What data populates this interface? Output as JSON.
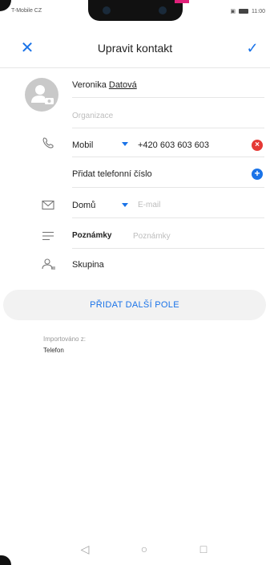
{
  "status_bar": {
    "carrier": "T-Mobile CZ",
    "time": "11:00"
  },
  "header": {
    "title": "Upravit kontakt"
  },
  "contact": {
    "first_name": "Veronika",
    "last_name": "Datová",
    "organization_placeholder": "Organizace"
  },
  "phone": {
    "type_label": "Mobil",
    "number": "+420 603 603 603",
    "add_label": "Přidat telefonní číslo"
  },
  "email": {
    "type_label": "Domů",
    "placeholder": "E-mail"
  },
  "notes": {
    "label": "Poznámky",
    "placeholder": "Poznámky"
  },
  "group": {
    "label": "Skupina"
  },
  "add_field_button": "PŘIDAT DALŠÍ POLE",
  "import_info": {
    "label": "Importováno z:",
    "value": "Telefon"
  },
  "icons": {
    "close": "close-icon",
    "confirm": "check-icon",
    "avatar": "add-photo-avatar-icon",
    "phone": "phone-icon",
    "email": "envelope-icon",
    "notes": "notes-icon",
    "group": "group-icon",
    "remove": "remove-icon",
    "add": "add-icon",
    "nav_back": "back-triangle-icon",
    "nav_home": "home-circle-icon",
    "nav_recent": "recent-square-icon"
  },
  "colors": {
    "accent": "#1a73e8",
    "remove": "#e53935"
  }
}
